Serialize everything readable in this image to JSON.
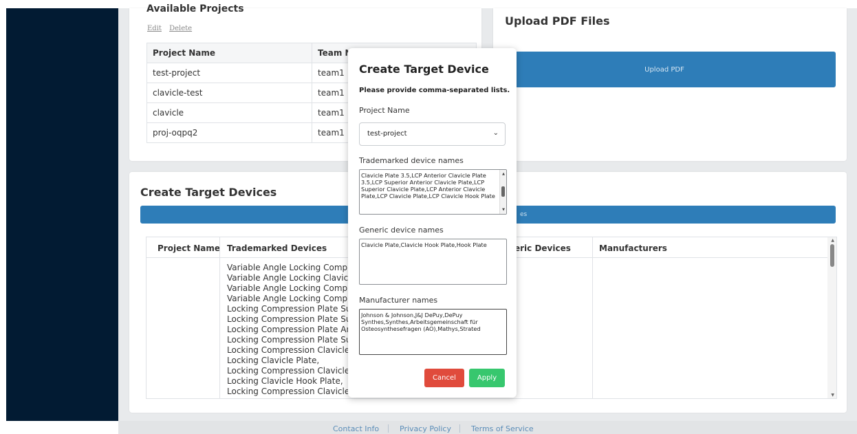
{
  "projects_card": {
    "title": "Available Projects",
    "edit_link": "Edit",
    "delete_link": "Delete",
    "columns": [
      "Project Name",
      "Team N"
    ],
    "rows": [
      [
        "test-project",
        "team1"
      ],
      [
        "clavicle-test",
        "team1"
      ],
      [
        "clavicle",
        "team1"
      ],
      [
        "proj-oqpq2",
        "team1"
      ]
    ]
  },
  "upload_card": {
    "title": "Upload PDF Files",
    "button_label": "Upload PDF"
  },
  "devices_card": {
    "title": "Create Target Devices",
    "bar_text": "es",
    "columns": [
      "Project Name",
      "Trademarked Devices",
      "eric Devices",
      "Manufacturers"
    ],
    "trademarked_lines": [
      "Variable Angle Locking Compressio",
      "Variable Angle Locking Clavicle Plat",
      "Variable Angle Locking Compressio",
      "Variable Angle Locking Compressio",
      "Locking Compression Plate Superic",
      "Locking Compression Plate Superic",
      "Locking Compression Plate Anterio",
      "Locking Compression Plate Superic",
      "Locking Compression Clavicle Hook",
      "Locking Clavicle Plate,",
      "Locking Compression Clavicle Plate",
      "Locking Clavicle Hook Plate,",
      "Locking Compression Clavicle Hook"
    ]
  },
  "footer": {
    "links": [
      "Contact Info",
      "Privacy Policy",
      "Terms of Service"
    ]
  },
  "modal": {
    "title": "Create Target Device",
    "subtitle": "Please provide comma-separated lists.",
    "project_label": "Project Name",
    "project_value": "test-project",
    "trademarked_label": "Trademarked device names",
    "trademarked_value": "Clavicle Plate 3.5,LCP Anterior Clavicle Plate 3.5,LCP Superior Anterior Clavicle Plate,LCP Superior Clavicle Plate,LCP Anterior Clavicle Plate,LCP Clavicle Plate,LCP Clavicle Hook Plate",
    "generic_label": "Generic device names",
    "generic_value": "Clavicle Plate,Clavicle Hook Plate,Hook Plate",
    "manufacturer_label": "Manufacturer names",
    "manufacturer_value": "Johnson & Johnson,J&J DePuy,DePuy Synthes,Synthes,Arbeitsgemeinschaft für Osteosynthesefragen (AO),Mathys,Strated",
    "cancel_label": "Cancel",
    "apply_label": "Apply"
  },
  "colors": {
    "sidebar": "#021b33",
    "primary": "#2e7db8",
    "cancel": "#e04b3c",
    "apply": "#37c76e"
  }
}
